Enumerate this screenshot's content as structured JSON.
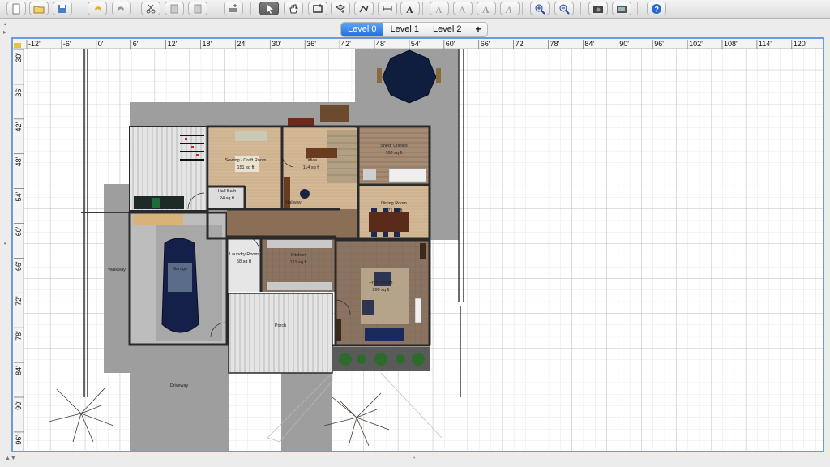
{
  "toolbar": {
    "buttons": [
      {
        "name": "new-home-button",
        "icon": "new-document-icon"
      },
      {
        "name": "open-button",
        "icon": "folder-icon"
      },
      {
        "name": "save-button",
        "icon": "save-icon"
      },
      {
        "name": "undo-button",
        "icon": "undo-icon"
      },
      {
        "name": "redo-button",
        "icon": "redo-icon"
      },
      {
        "name": "cut-button",
        "icon": "scissors-icon"
      },
      {
        "name": "copy-button",
        "icon": "copy-icon"
      },
      {
        "name": "paste-button",
        "icon": "paste-icon"
      },
      {
        "name": "add-furniture-button",
        "icon": "add-furniture-icon"
      },
      {
        "name": "select-mode-button",
        "icon": "arrow-pointer-icon",
        "active": true
      },
      {
        "name": "pan-mode-button",
        "icon": "hand-icon"
      },
      {
        "name": "create-walls-button",
        "icon": "walls-icon"
      },
      {
        "name": "create-rooms-button",
        "icon": "rooms-icon"
      },
      {
        "name": "create-polylines-button",
        "icon": "polyline-icon"
      },
      {
        "name": "create-dimensions-button",
        "icon": "dimension-icon"
      },
      {
        "name": "add-text-button",
        "icon": "text-icon"
      },
      {
        "name": "text-style-1-button",
        "icon": "text-style-icon"
      },
      {
        "name": "text-style-2-button",
        "icon": "text-style-icon"
      },
      {
        "name": "bold-text-button",
        "icon": "bold-icon"
      },
      {
        "name": "italic-text-button",
        "icon": "italic-icon"
      },
      {
        "name": "zoom-in-button",
        "icon": "zoom-in-icon"
      },
      {
        "name": "zoom-out-button",
        "icon": "zoom-out-icon"
      },
      {
        "name": "create-photo-button",
        "icon": "camera-icon"
      },
      {
        "name": "create-video-button",
        "icon": "video-icon"
      },
      {
        "name": "help-button",
        "icon": "help-icon"
      }
    ]
  },
  "level_tabs": [
    {
      "label": "Level 0",
      "selected": true
    },
    {
      "label": "Level 1",
      "selected": false
    },
    {
      "label": "Level 2",
      "selected": false
    },
    {
      "label": "+",
      "selected": false
    }
  ],
  "ruler": {
    "h_labels": [
      "-12'",
      "-6'",
      "0'",
      "6'",
      "12'",
      "18'",
      "24'",
      "30'",
      "36'",
      "42'",
      "48'",
      "54'",
      "60'",
      "66'",
      "72'",
      "78'",
      "84'",
      "90'",
      "96'",
      "102'",
      "108'",
      "114'",
      "120'"
    ],
    "v_labels": [
      "30'",
      "36'",
      "42'",
      "48'",
      "54'",
      "60'",
      "66'",
      "72'",
      "78'",
      "84'",
      "90'",
      "96'"
    ]
  },
  "rooms": {
    "sewing": {
      "name": "Sewing / Craft Room",
      "area": "151 sq ft"
    },
    "office": {
      "name": "Office",
      "area": "114 sq ft"
    },
    "shed": {
      "name": "Shed/ Utilities",
      "area": "108 sq ft"
    },
    "bath": {
      "name": "Half Bath",
      "area": "24 sq ft"
    },
    "hallway": {
      "name": "Hallway"
    },
    "dining": {
      "name": "Dining Room",
      "area": "171 sq ft"
    },
    "laundry": {
      "name": "Laundry Room",
      "area": "58 sq ft"
    },
    "kitchen": {
      "name": "Kitchen",
      "area": "121 sq ft"
    },
    "front": {
      "name": "Front Room",
      "area": "260 sq ft"
    },
    "garage": {
      "name": "Garage"
    },
    "walkway": {
      "name": "Walkway"
    },
    "porch": {
      "name": "Porch"
    },
    "driveway": {
      "name": "Driveway"
    }
  },
  "colors": {
    "accent": "#1e6fe0",
    "plan_border": "#6b9bd8",
    "concrete": "#9e9e9e",
    "wall": "#2a2a2a",
    "wood_floor": "#d3b896",
    "tile_floor": "#8a7360"
  }
}
